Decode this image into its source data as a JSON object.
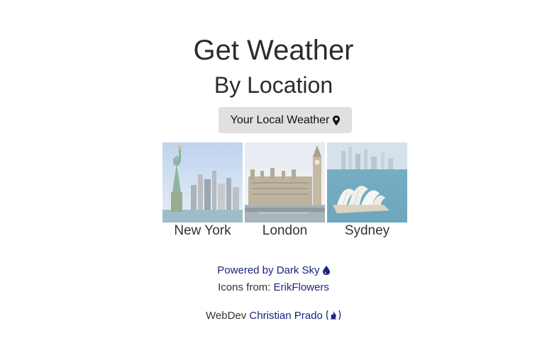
{
  "header": {
    "title": "Get Weather",
    "subtitle": "By Location"
  },
  "local_button": {
    "label": "Your Local Weather",
    "icon": "map-marker-icon"
  },
  "cities": [
    {
      "name": "New York",
      "image": "statue-of-liberty-skyline"
    },
    {
      "name": "London",
      "image": "big-ben-parliament"
    },
    {
      "name": "Sydney",
      "image": "sydney-opera-house"
    }
  ],
  "footer": {
    "powered_prefix": "Powered by ",
    "powered_link": "Dark Sky",
    "icons_prefix": "Icons from: ",
    "icons_link": "ErikFlowers",
    "webdev_prefix": "WebDev ",
    "webdev_link": "Christian Prado",
    "link_color": "#1a237e"
  }
}
